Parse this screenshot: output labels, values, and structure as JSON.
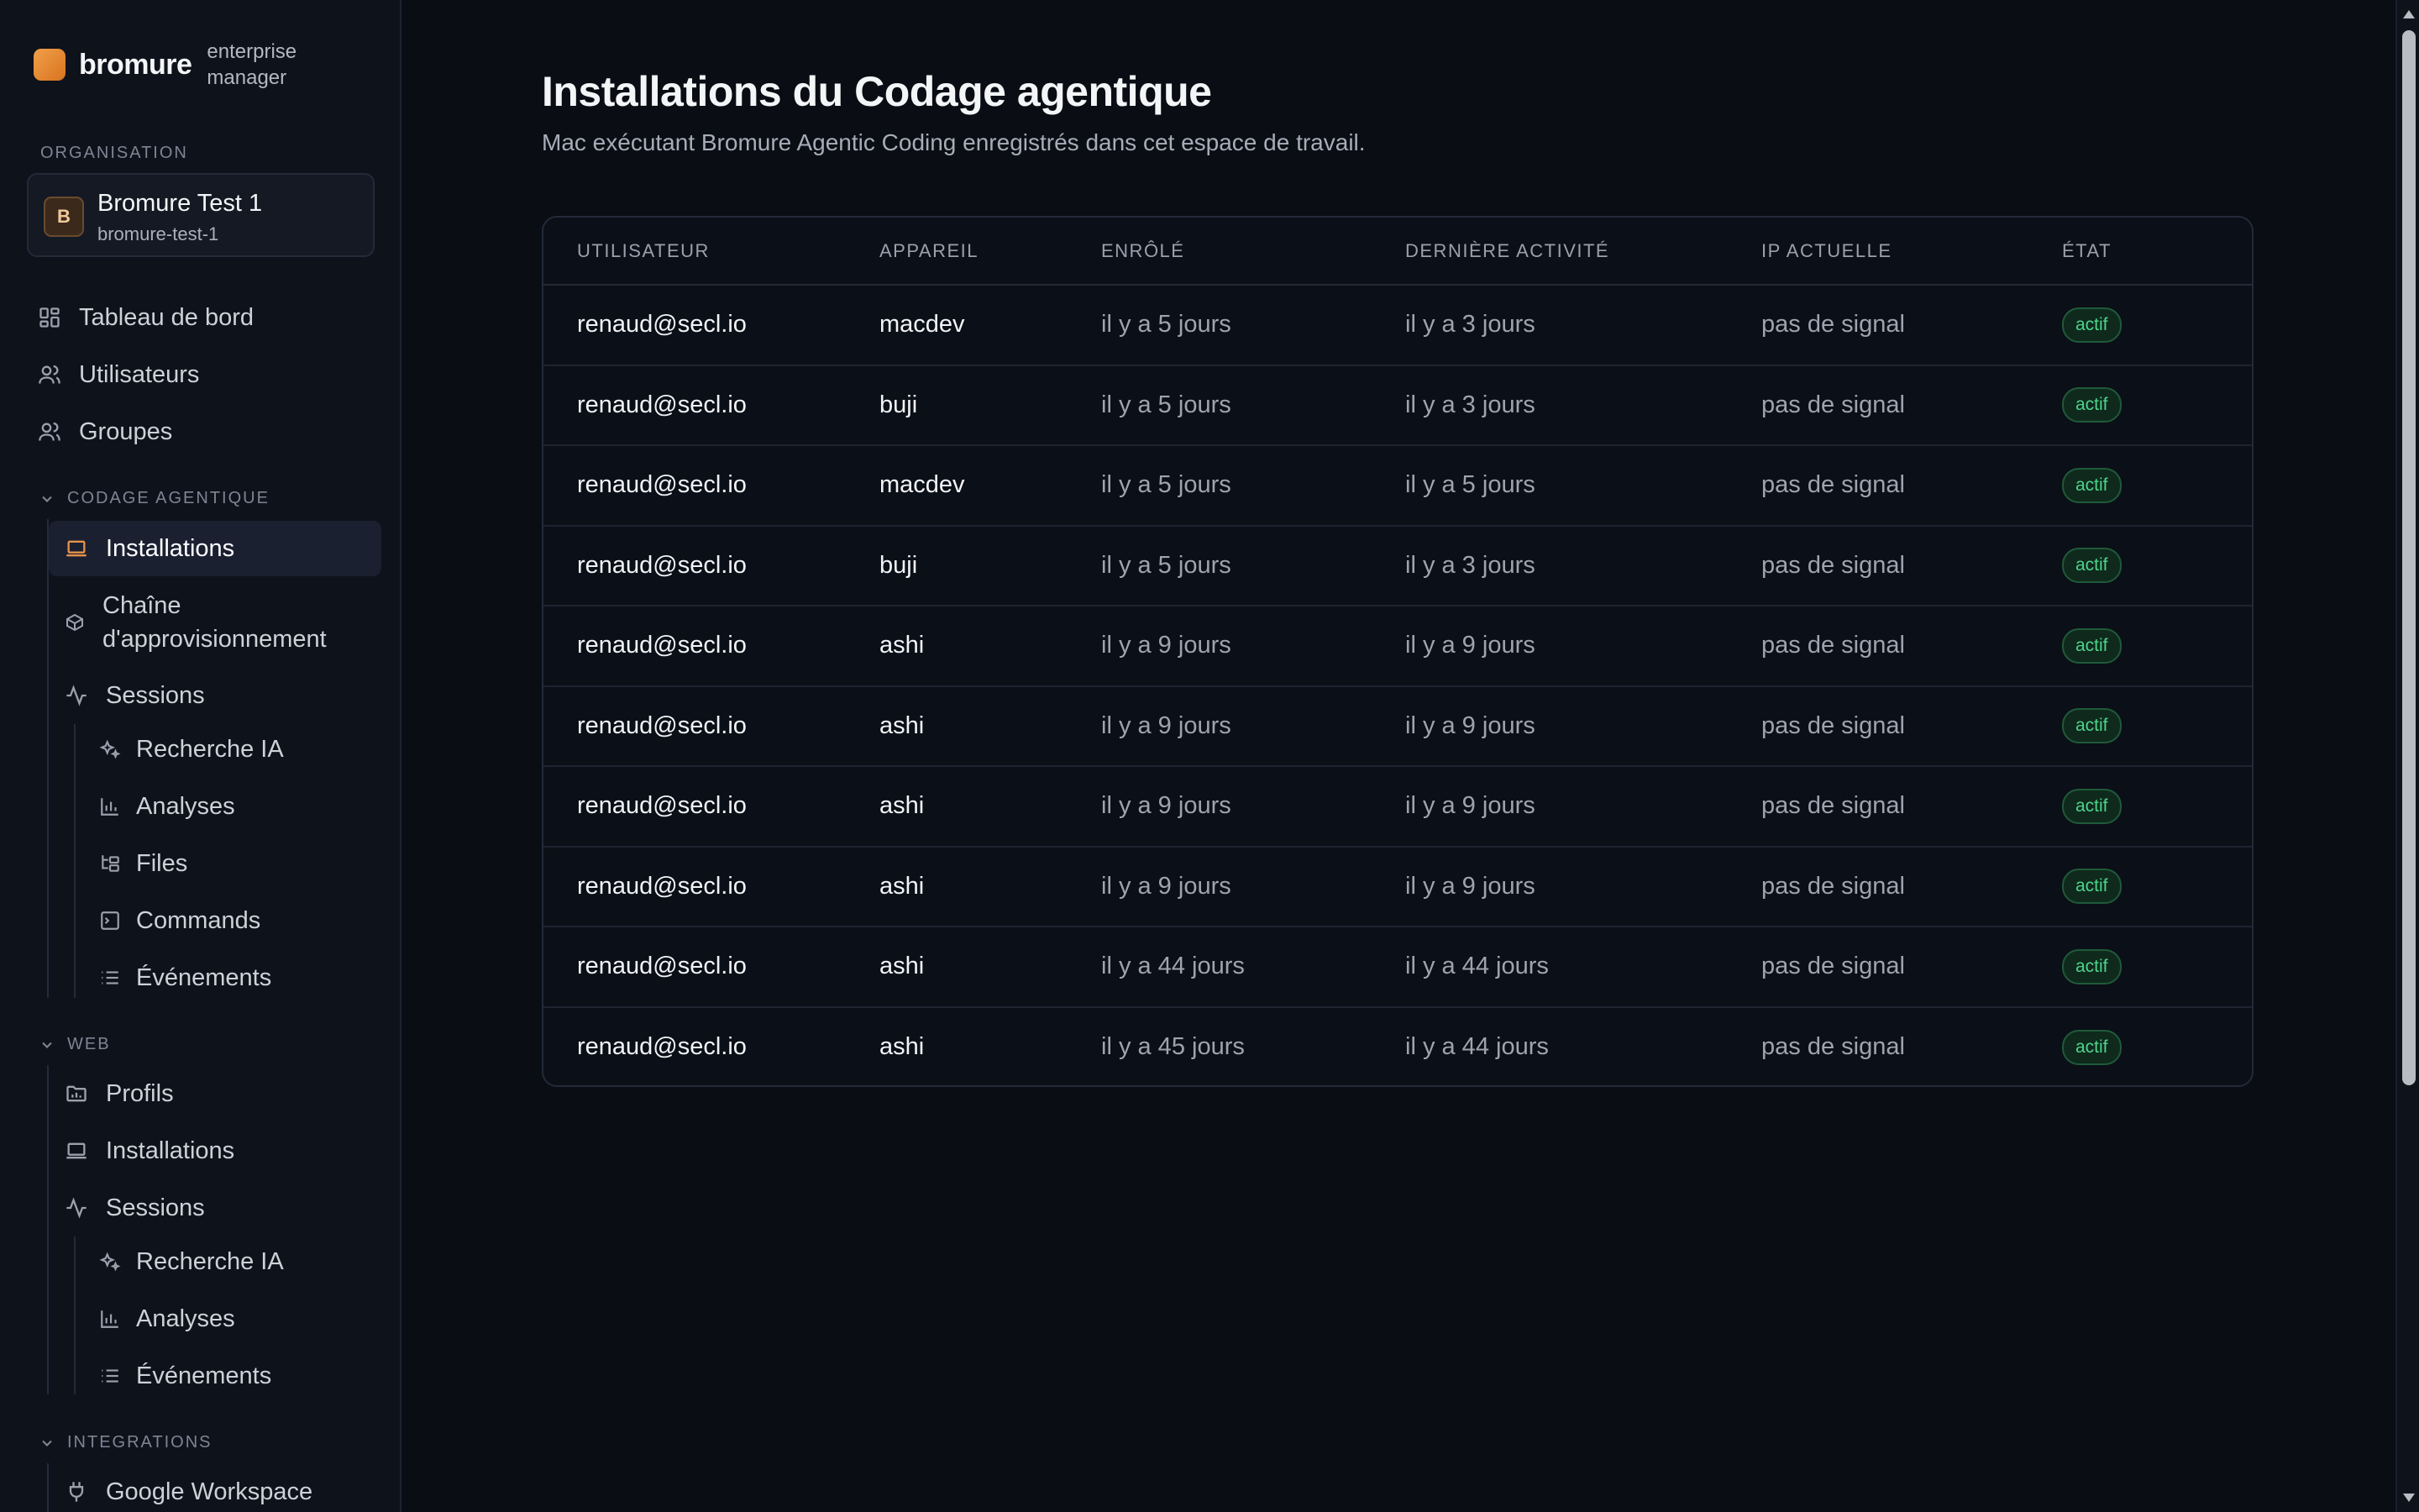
{
  "brand": {
    "name": "bromure",
    "subtitle": "enterprise manager"
  },
  "sidebar": {
    "org_label": "ORGANISATION",
    "org": {
      "initial": "B",
      "name": "Bromure Test 1",
      "slug": "bromure-test-1"
    },
    "top_items": [
      {
        "label": "Tableau de bord",
        "icon": "dashboard-icon"
      },
      {
        "label": "Utilisateurs",
        "icon": "users-icon"
      },
      {
        "label": "Groupes",
        "icon": "groups-icon"
      }
    ],
    "codage": {
      "label": "CODAGE AGENTIQUE",
      "items": [
        {
          "label": "Installations",
          "icon": "laptop-icon",
          "active": true
        },
        {
          "label": "Chaîne d'approvisionnement",
          "icon": "package-icon"
        },
        {
          "label": "Sessions",
          "icon": "activity-icon"
        }
      ],
      "session_children": [
        {
          "label": "Recherche IA",
          "icon": "sparkles-icon"
        },
        {
          "label": "Analyses",
          "icon": "bar-chart-icon"
        },
        {
          "label": "Files",
          "icon": "folder-tree-icon"
        },
        {
          "label": "Commands",
          "icon": "terminal-icon"
        },
        {
          "label": "Événements",
          "icon": "list-icon"
        }
      ]
    },
    "web": {
      "label": "WEB",
      "items": [
        {
          "label": "Profils",
          "icon": "folder-icon"
        },
        {
          "label": "Installations",
          "icon": "laptop-icon"
        },
        {
          "label": "Sessions",
          "icon": "activity-icon"
        }
      ],
      "session_children": [
        {
          "label": "Recherche IA",
          "icon": "sparkles-icon"
        },
        {
          "label": "Analyses",
          "icon": "bar-chart-icon"
        },
        {
          "label": "Événements",
          "icon": "list-icon"
        }
      ]
    },
    "integrations": {
      "label": "INTEGRATIONS",
      "items": [
        {
          "label": "Google Workspace",
          "icon": "plug-icon"
        }
      ]
    }
  },
  "main": {
    "title": "Installations du Codage agentique",
    "subtitle": "Mac exécutant Bromure Agentic Coding enregistrés dans cet espace de travail.",
    "columns": [
      "UTILISATEUR",
      "APPAREIL",
      "ENRÔLÉ",
      "DERNIÈRE ACTIVITÉ",
      "IP ACTUELLE",
      "ÉTAT"
    ],
    "rows": [
      {
        "user": "renaud@secl.io",
        "device": "macdev",
        "enrolled": "il y a 5 jours",
        "last": "il y a 3 jours",
        "ip": "pas de signal",
        "state": "actif"
      },
      {
        "user": "renaud@secl.io",
        "device": "buji",
        "enrolled": "il y a 5 jours",
        "last": "il y a 3 jours",
        "ip": "pas de signal",
        "state": "actif"
      },
      {
        "user": "renaud@secl.io",
        "device": "macdev",
        "enrolled": "il y a 5 jours",
        "last": "il y a 5 jours",
        "ip": "pas de signal",
        "state": "actif"
      },
      {
        "user": "renaud@secl.io",
        "device": "buji",
        "enrolled": "il y a 5 jours",
        "last": "il y a 3 jours",
        "ip": "pas de signal",
        "state": "actif"
      },
      {
        "user": "renaud@secl.io",
        "device": "ashi",
        "enrolled": "il y a 9 jours",
        "last": "il y a 9 jours",
        "ip": "pas de signal",
        "state": "actif"
      },
      {
        "user": "renaud@secl.io",
        "device": "ashi",
        "enrolled": "il y a 9 jours",
        "last": "il y a 9 jours",
        "ip": "pas de signal",
        "state": "actif"
      },
      {
        "user": "renaud@secl.io",
        "device": "ashi",
        "enrolled": "il y a 9 jours",
        "last": "il y a 9 jours",
        "ip": "pas de signal",
        "state": "actif"
      },
      {
        "user": "renaud@secl.io",
        "device": "ashi",
        "enrolled": "il y a 9 jours",
        "last": "il y a 9 jours",
        "ip": "pas de signal",
        "state": "actif"
      },
      {
        "user": "renaud@secl.io",
        "device": "ashi",
        "enrolled": "il y a 44 jours",
        "last": "il y a 44 jours",
        "ip": "pas de signal",
        "state": "actif"
      },
      {
        "user": "renaud@secl.io",
        "device": "ashi",
        "enrolled": "il y a 45 jours",
        "last": "il y a 44 jours",
        "ip": "pas de signal",
        "state": "actif"
      }
    ]
  },
  "colors": {
    "accent": "#e7914a",
    "status_active": "#4ed38b",
    "background": "#0a0d14"
  }
}
